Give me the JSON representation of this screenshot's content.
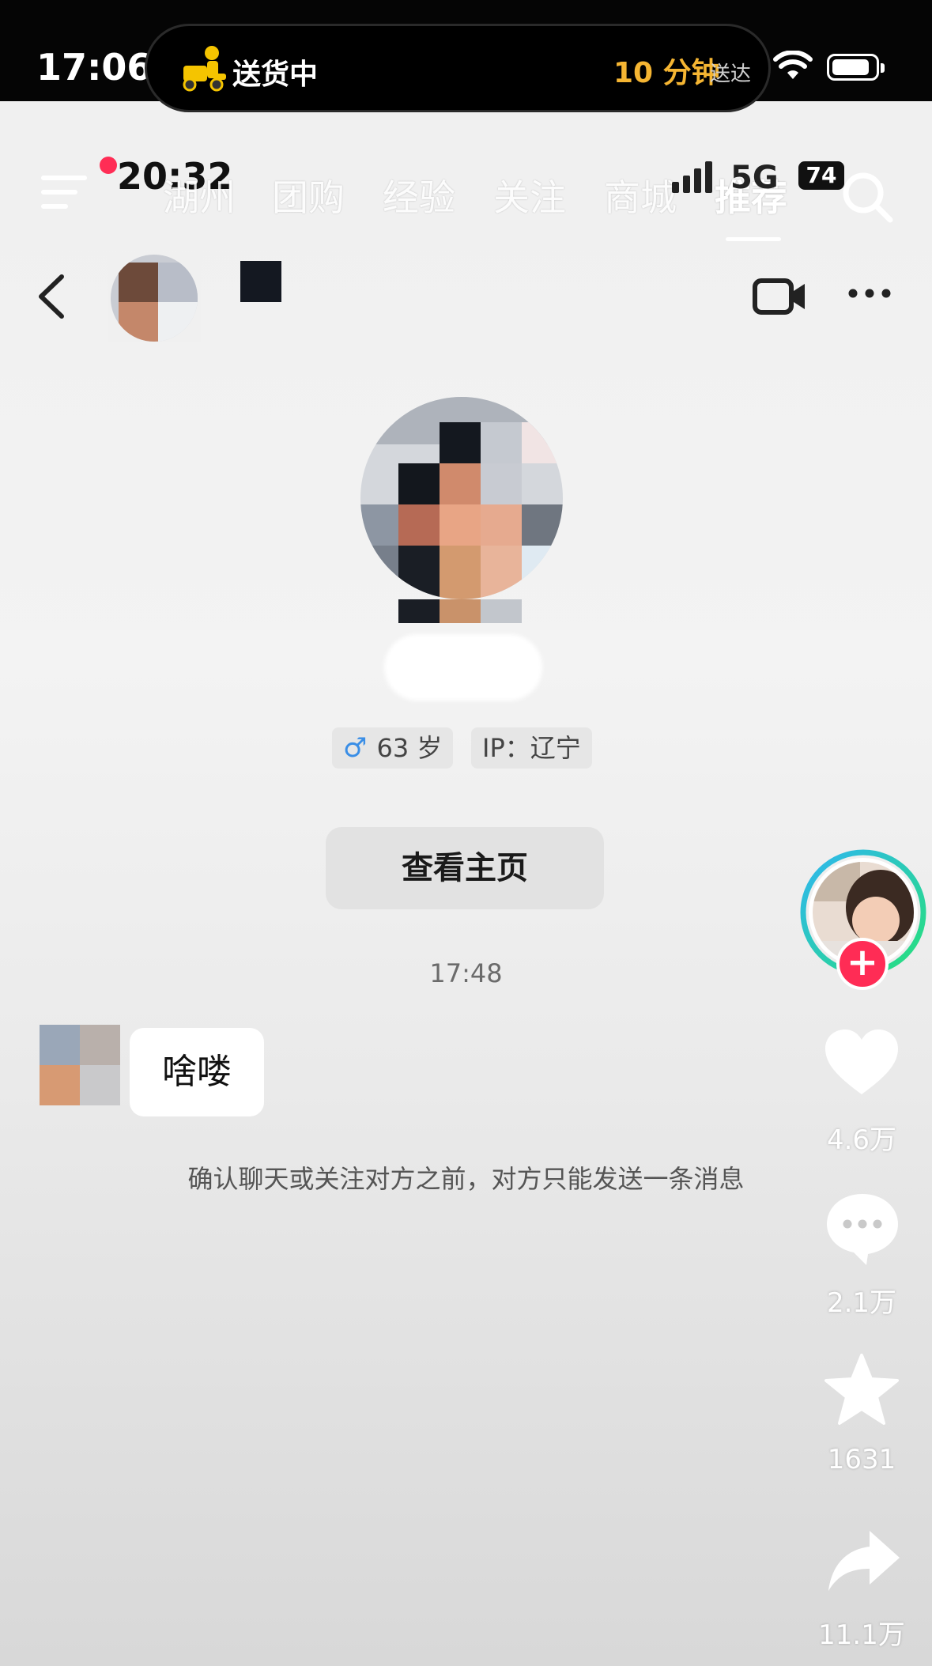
{
  "status_bar": {
    "time": "17:06",
    "island": {
      "status": "送货中",
      "eta": "10 分钟",
      "eta_suffix": "送达"
    }
  },
  "feed_overlay": {
    "time": "20:32",
    "network": "5G",
    "battery": "74",
    "tabs": [
      {
        "label": "湖州"
      },
      {
        "label": "团购"
      },
      {
        "label": "经验"
      },
      {
        "label": "关注"
      },
      {
        "label": "商城"
      },
      {
        "label": "推荐",
        "active": true
      }
    ]
  },
  "chat": {
    "profile": {
      "gender_symbol": "♂",
      "age": "63 岁",
      "ip": "IP：辽宁",
      "view_profile_label": "查看主页"
    },
    "message_time": "17:48",
    "messages": [
      {
        "from": "other",
        "text": "啥喽"
      }
    ],
    "notice": "确认聊天或关注对方之前，对方只能发送一条消息"
  },
  "right_rail": {
    "likes": "4.6万",
    "comments": "2.1万",
    "favorites": "1631",
    "shares": "11.1万"
  },
  "colors": {
    "accent_red": "#ff2c55",
    "island_eta": "#f5b532",
    "male_blue": "#3a8ee6"
  }
}
